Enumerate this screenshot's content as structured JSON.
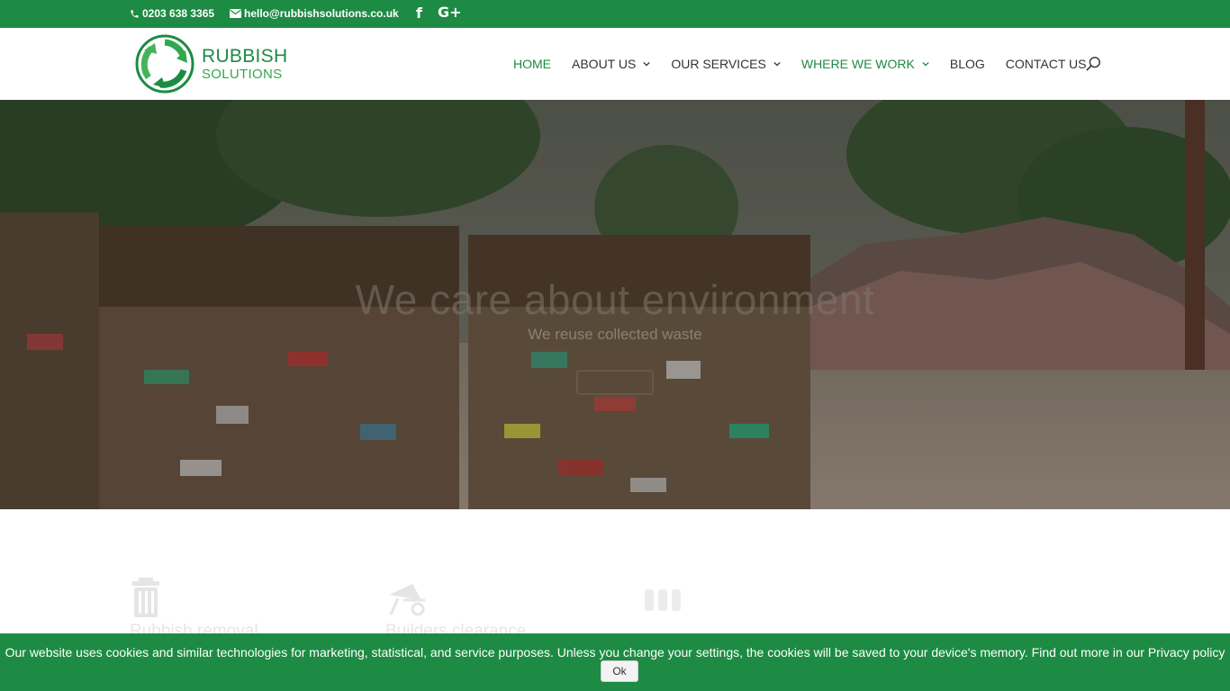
{
  "topbar": {
    "phone": "0203 638 3365",
    "email": "hello@rubbishsolutions.co.uk",
    "facebook_glyph": "f",
    "googleplus_glyph": "G+"
  },
  "logo": {
    "line1": "RUBBISH",
    "line2": "SOLUTIONS"
  },
  "nav": {
    "items": [
      {
        "label": "HOME",
        "active": true,
        "dropdown": false
      },
      {
        "label": "ABOUT US",
        "active": false,
        "dropdown": true
      },
      {
        "label": "OUR SERVICES",
        "active": false,
        "dropdown": true
      },
      {
        "label": "WHERE WE WORK",
        "active": true,
        "dropdown": true
      },
      {
        "label": "BLOG",
        "active": false,
        "dropdown": false
      },
      {
        "label": "CONTACT US",
        "active": false,
        "dropdown": false
      }
    ]
  },
  "hero": {
    "title": "We care about environment",
    "subtitle": "We reuse collected waste"
  },
  "features": [
    {
      "label": "Rubbish removal",
      "icon": "trash-icon"
    },
    {
      "label": "Builders clearance",
      "icon": "wheelbarrow-icon"
    },
    {
      "label": "",
      "icon": "bins-icon"
    }
  ],
  "cookie": {
    "message": "Our website uses cookies and similar technologies for marketing, statistical, and service purposes. Unless you change your settings, the cookies will be saved to your device's memory. Find out more in our Privacy policy",
    "ok_label": "Ok"
  },
  "colors": {
    "brand_green": "#1d8b43",
    "nav_text": "#333333"
  }
}
